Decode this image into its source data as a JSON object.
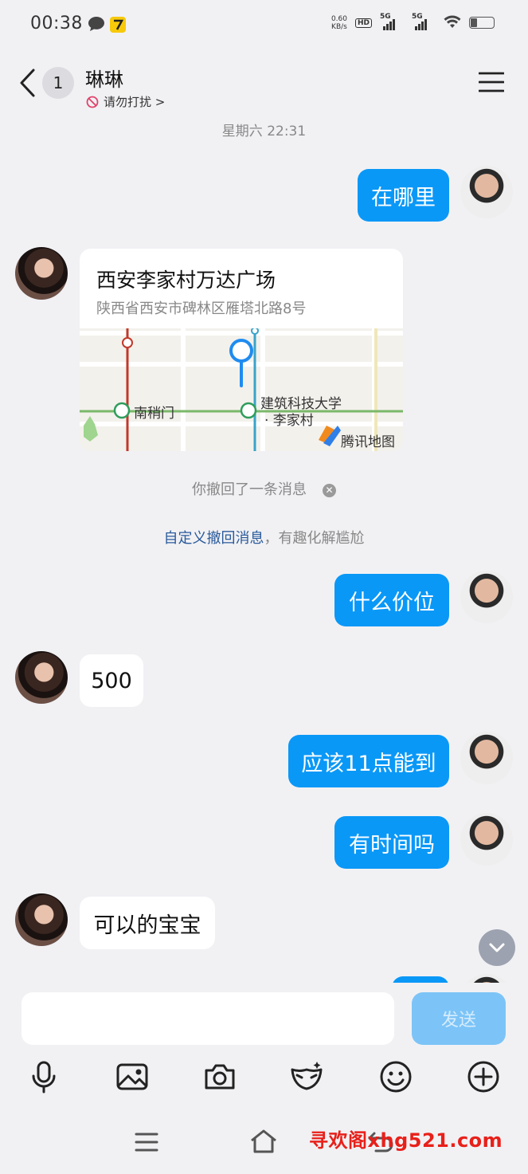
{
  "status_bar": {
    "time": "00:38",
    "net_speed_value": "0.60",
    "net_speed_unit": "KB/s",
    "hd_label": "HD",
    "hd_sup": "1",
    "hd_sub": "2",
    "signal_1": "5G",
    "signal_2": "5G"
  },
  "header": {
    "back_icon": "chevron-left-icon",
    "unread_count": "1",
    "title": "琳琳",
    "dnd_label": "请勿打扰 >",
    "menu_icon": "hamburger-icon"
  },
  "timestamp": "星期六 22:31",
  "messages": {
    "m1": "在哪里",
    "m3": "什么价位",
    "m4": "500",
    "m5": "应该11点能到",
    "m6": "有时间吗",
    "m7": "可以的宝宝"
  },
  "location_card": {
    "name": "西安李家村万达广场",
    "address": "陕西省西安市碑林区雁塔北路8号",
    "map_label_1": "南稍门",
    "map_label_2a": "建筑科技大学",
    "map_label_2b": "· 李家村",
    "map_brand": "腾讯地图"
  },
  "recall": {
    "notice": "你撤回了一条消息",
    "tip_link": "自定义撤回消息",
    "tip_rest": "，有趣化解尴尬"
  },
  "input": {
    "placeholder": "",
    "send_label": "发送"
  },
  "toolbar_icons": [
    "mic-icon",
    "image-icon",
    "camera-icon",
    "mask-icon",
    "emoji-icon",
    "plus-icon"
  ],
  "watermark": "寻欢阁xhg521.com",
  "colors": {
    "outgoing_bubble": "#0a98f7",
    "incoming_bubble": "#ffffff",
    "background": "#f1f1f4",
    "send_button_disabled": "#7cc4f7",
    "link": "#2a5a9b",
    "watermark": "#e8201a"
  }
}
